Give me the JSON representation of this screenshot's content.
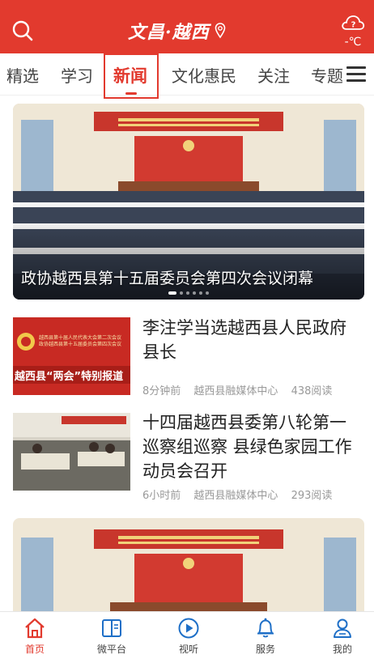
{
  "header": {
    "logo_text": "文昌·越西",
    "search_icon": "search-icon",
    "weather_icon": "cloud-question-icon",
    "temperature": "-℃",
    "brand_color": "#e23a2e"
  },
  "tabs": [
    {
      "label": "精选"
    },
    {
      "label": "学习"
    },
    {
      "label": "新闻"
    },
    {
      "label": "文化惠民"
    },
    {
      "label": "关注"
    },
    {
      "label": "专题"
    }
  ],
  "active_tab": "新闻",
  "banner": {
    "caption": "政协越西县第十五届委员会第四次会议闭幕",
    "slide_count": 6,
    "active_slide": 1
  },
  "news": [
    {
      "title": "李注学当选越西县人民政府县长",
      "time": "8分钟前",
      "source": "越西县融媒体中心",
      "reads": "438阅读",
      "thumb_text_top": "越西县第十届人民代表大会第二次会议\n政协越西县第十五届委员会第四次会议",
      "thumb_text_main": "越西县“两会”特别报道"
    },
    {
      "title": "十四届越西县委第八轮第一巡察组巡察 县绿色家园工作动员会召开",
      "time": "6小时前",
      "source": "越西县融媒体中心",
      "reads": "293阅读"
    }
  ],
  "bottom_nav": [
    {
      "label": "首页",
      "icon": "home-icon"
    },
    {
      "label": "微平台",
      "icon": "book-icon"
    },
    {
      "label": "视听",
      "icon": "play-icon"
    },
    {
      "label": "服务",
      "icon": "bell-icon"
    },
    {
      "label": "我的",
      "icon": "user-icon"
    }
  ]
}
